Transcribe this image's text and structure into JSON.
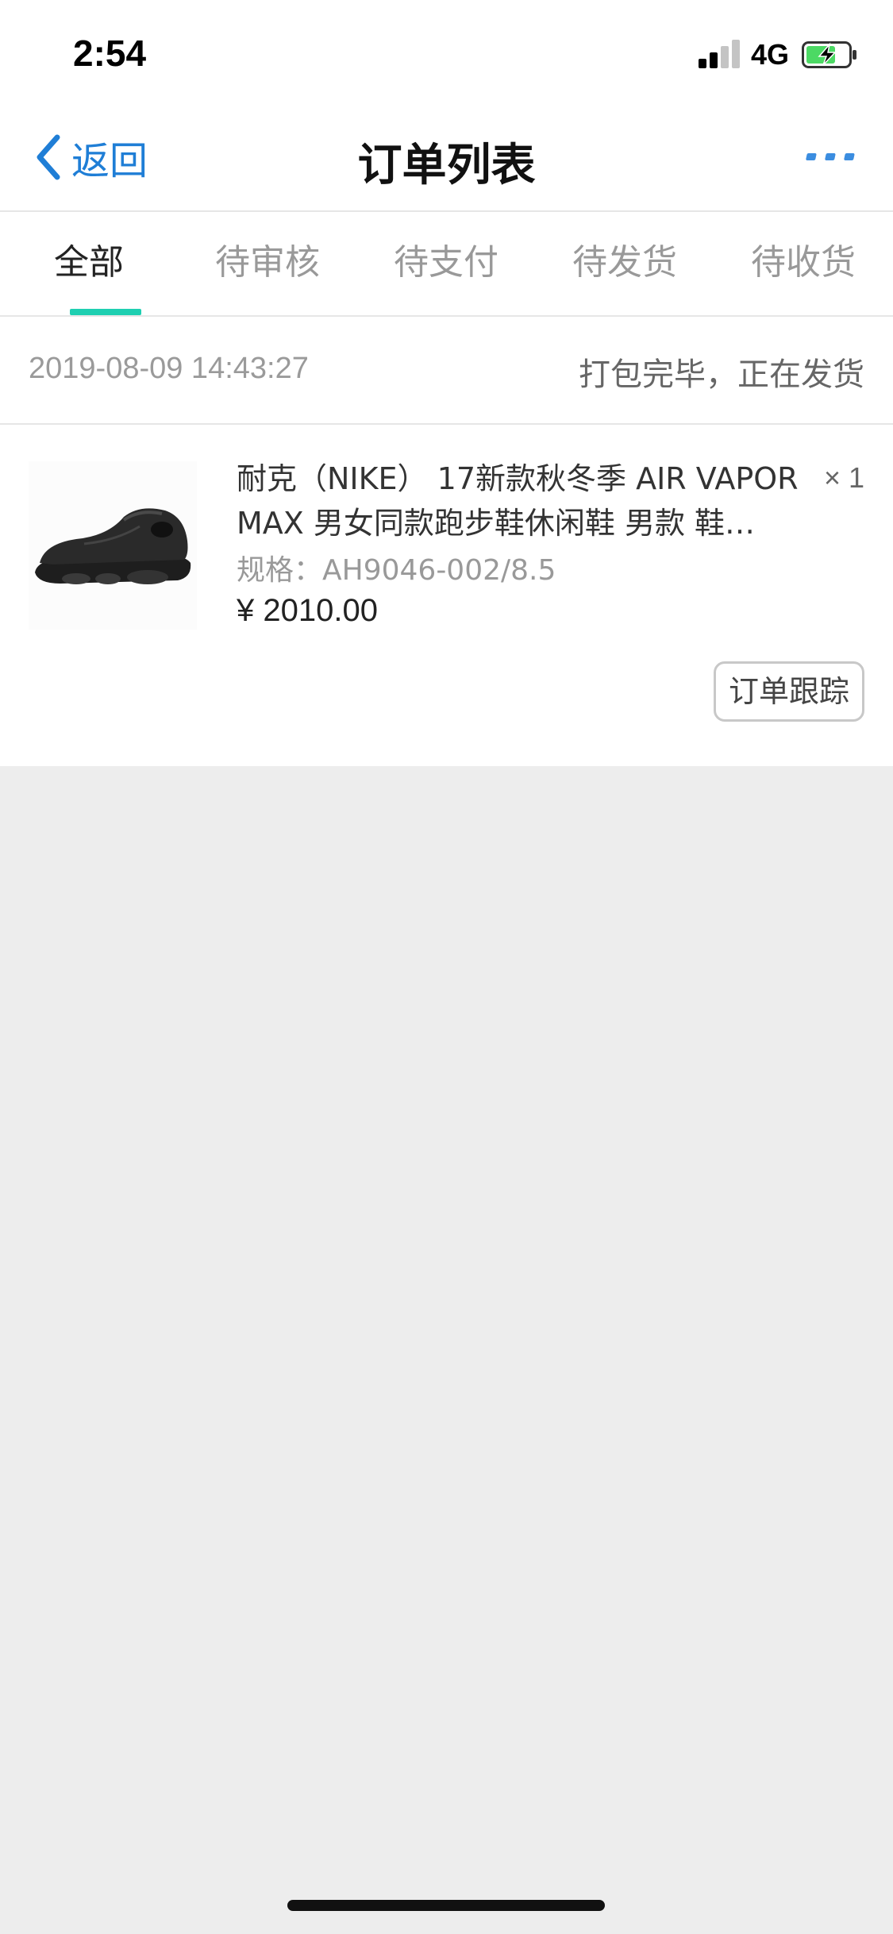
{
  "status_bar": {
    "time": "2:54",
    "network": "4G",
    "signal_bars": 2,
    "battery_charging": true
  },
  "nav": {
    "back_label": "返回",
    "title": "订单列表",
    "more_icon": "more-dots-icon"
  },
  "tabs": [
    {
      "label": "全部",
      "active": true
    },
    {
      "label": "待审核",
      "active": false
    },
    {
      "label": "待支付",
      "active": false
    },
    {
      "label": "待发货",
      "active": false
    },
    {
      "label": "待收货",
      "active": false
    }
  ],
  "order": {
    "date": "2019-08-09 14:43:27",
    "status": "打包完毕，正在发货",
    "product": {
      "name": "耐克（NIKE） 17新款秋冬季 AIR VAPORMAX 男女同款跑步鞋休闲鞋 男款 鞋…",
      "quantity": "× 1",
      "spec": "规格：AH9046-002/8.5",
      "price": "¥ 2010.00",
      "image_icon": "sneaker-image"
    },
    "track_button": "订单跟踪"
  },
  "colors": {
    "accent_blue": "#1f7ed6",
    "tab_indicator": "#1ecfb1",
    "page_bg": "#ededed"
  }
}
